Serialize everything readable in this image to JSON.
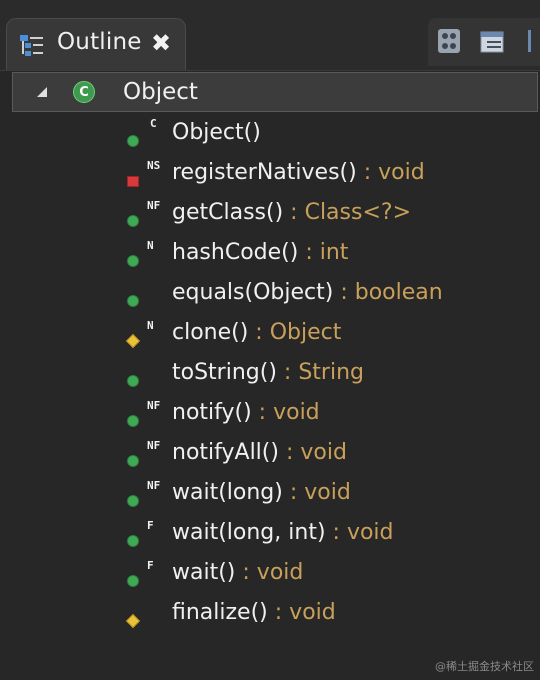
{
  "tab": {
    "title": "Outline",
    "close": "✖"
  },
  "toolbar": {
    "icons": [
      "hierarchy-icon",
      "collapse-all-icon",
      "more-icon"
    ]
  },
  "root": {
    "label": "Object",
    "icon": "class-icon",
    "badge": "C"
  },
  "members": [
    {
      "name": "Object()",
      "sep": "",
      "type": "",
      "visibility": "public",
      "decor": "C"
    },
    {
      "name": "registerNatives()",
      "sep": " : ",
      "type": "void",
      "visibility": "private",
      "decor": "NS"
    },
    {
      "name": "getClass()",
      "sep": " : ",
      "type": "Class<?>",
      "visibility": "public",
      "decor": "NF"
    },
    {
      "name": "hashCode()",
      "sep": " : ",
      "type": "int",
      "visibility": "public",
      "decor": "N"
    },
    {
      "name": "equals(Object)",
      "sep": " : ",
      "type": "boolean",
      "visibility": "public",
      "decor": ""
    },
    {
      "name": "clone()",
      "sep": " : ",
      "type": "Object",
      "visibility": "protected",
      "decor": "N"
    },
    {
      "name": "toString()",
      "sep": " : ",
      "type": "String",
      "visibility": "public",
      "decor": ""
    },
    {
      "name": "notify()",
      "sep": " : ",
      "type": "void",
      "visibility": "public",
      "decor": "NF"
    },
    {
      "name": "notifyAll()",
      "sep": " : ",
      "type": "void",
      "visibility": "public",
      "decor": "NF"
    },
    {
      "name": "wait(long)",
      "sep": " : ",
      "type": "void",
      "visibility": "public",
      "decor": "NF"
    },
    {
      "name": "wait(long, int)",
      "sep": " : ",
      "type": "void",
      "visibility": "public",
      "decor": "F"
    },
    {
      "name": "wait()",
      "sep": " : ",
      "type": "void",
      "visibility": "public",
      "decor": "F"
    },
    {
      "name": "finalize()",
      "sep": " : ",
      "type": "void",
      "visibility": "protected",
      "decor": ""
    }
  ],
  "watermark": "@稀土掘金技术社区",
  "colors": {
    "background": "#272727",
    "type": "#c9a05a",
    "public": "#3faa55",
    "private": "#d63a3a",
    "protected": "#e8c23a"
  }
}
